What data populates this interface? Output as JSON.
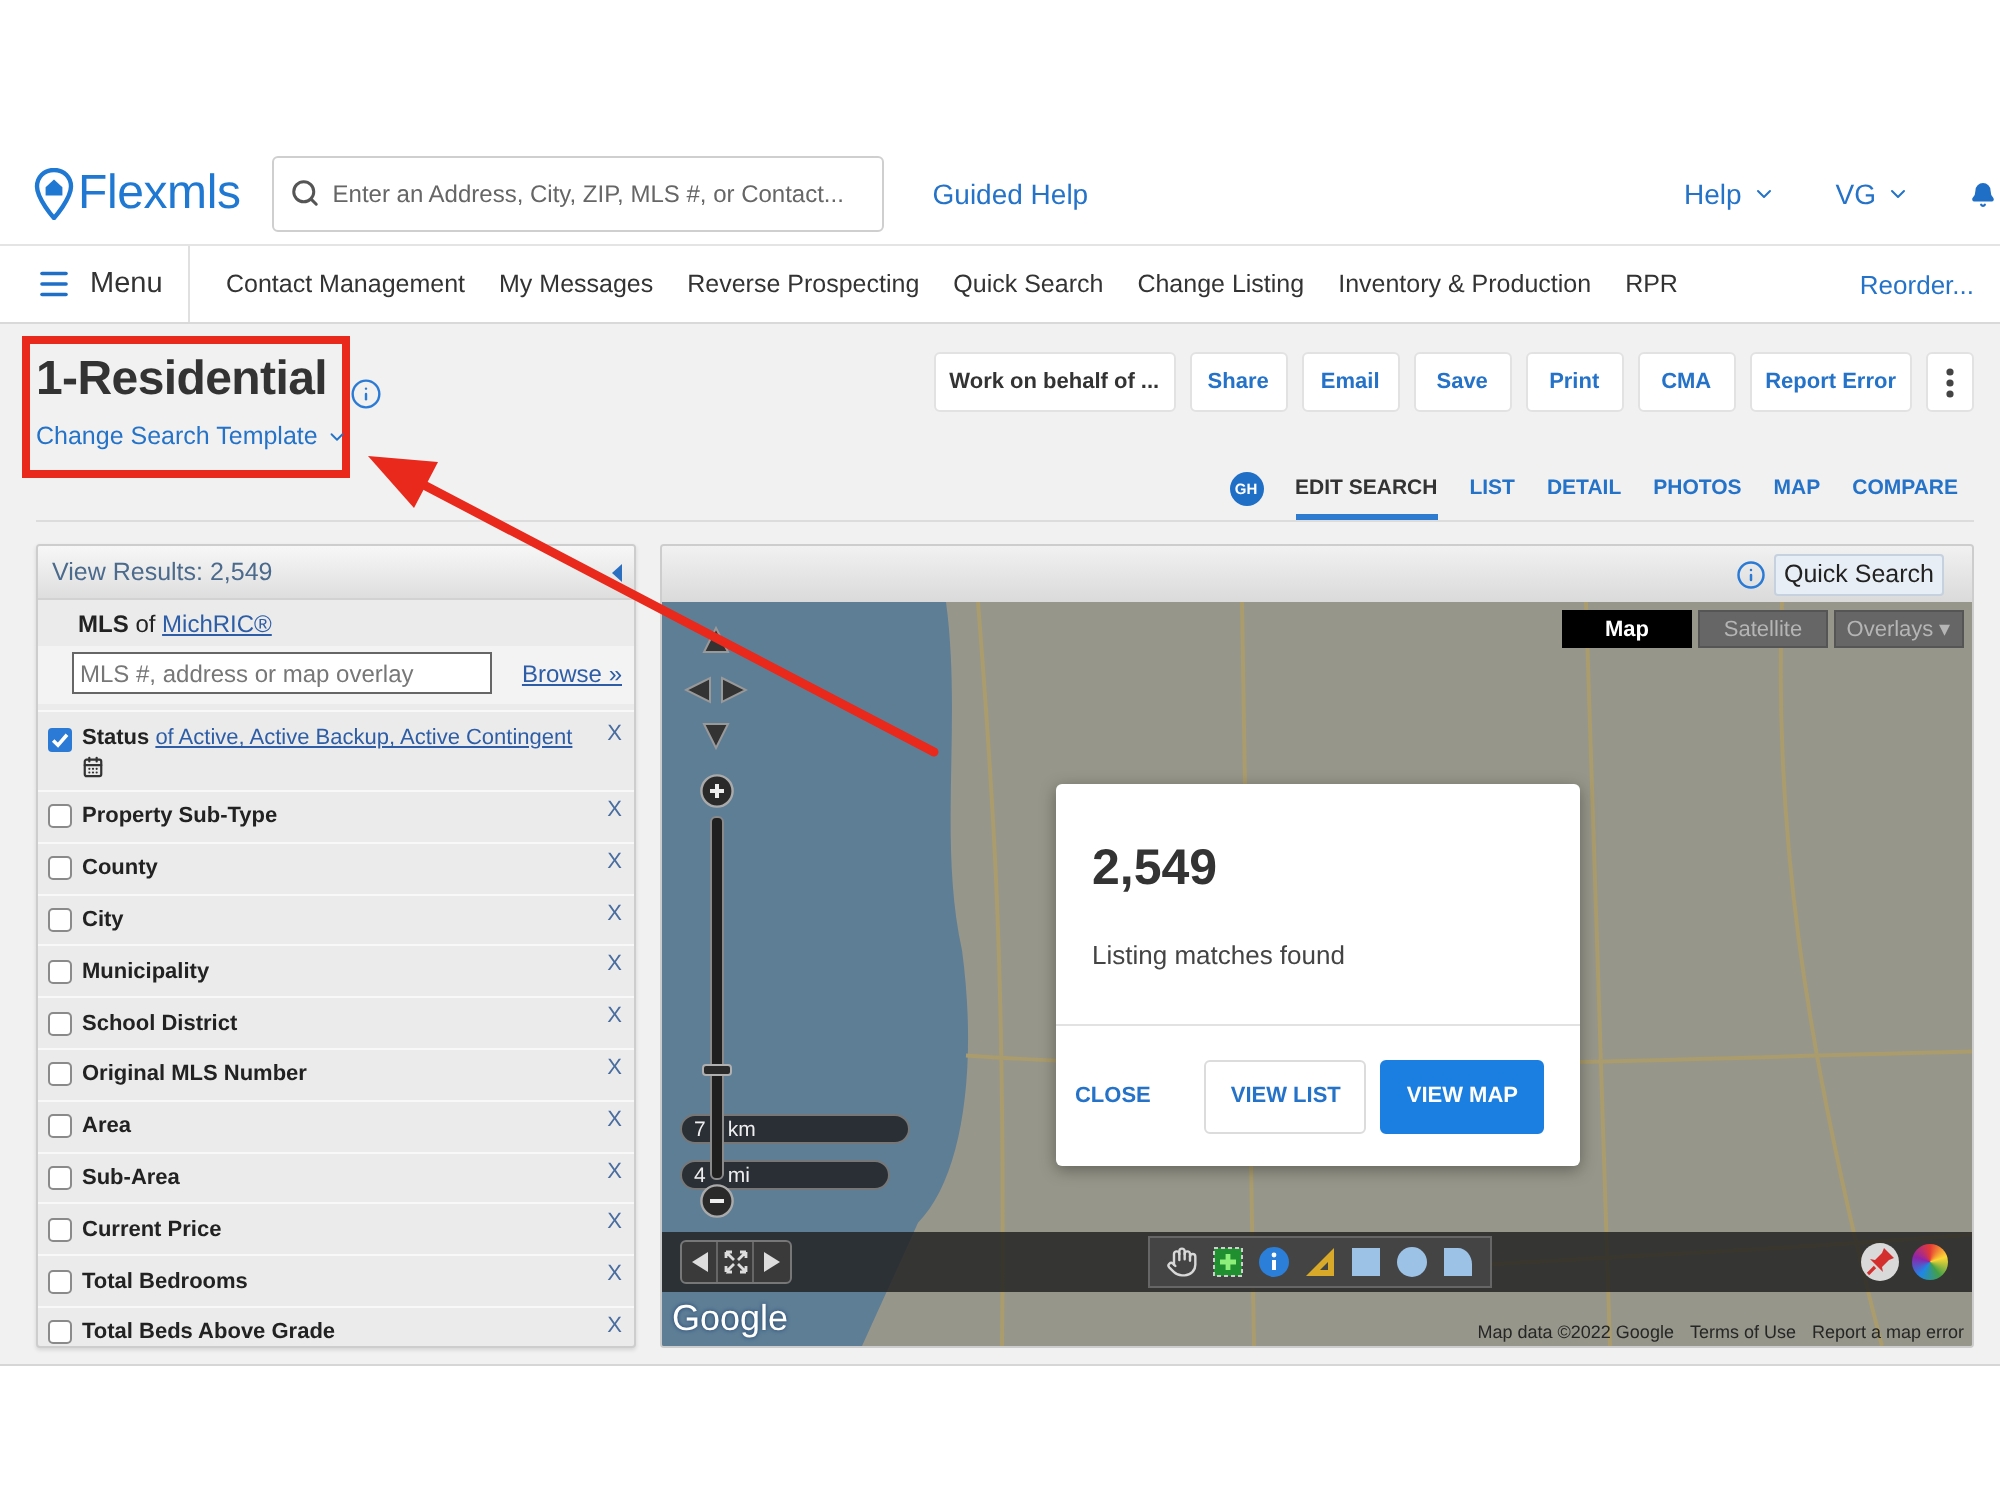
{
  "header": {
    "logo": "Flexmls",
    "search": {
      "placeholder": "Enter an Address, City, ZIP, MLS #, or Contact..."
    },
    "guided_help": "Guided Help",
    "menus": [
      {
        "label": "Help"
      },
      {
        "label": "VG"
      }
    ]
  },
  "nav": {
    "menu": "Menu",
    "items": [
      {
        "label": "Contact Management"
      },
      {
        "label": "My Messages"
      },
      {
        "label": "Reverse Prospecting"
      },
      {
        "label": "Quick Search"
      },
      {
        "label": "Change Listing"
      },
      {
        "label": "Inventory & Production"
      },
      {
        "label": "RPR"
      }
    ],
    "reorder": "Reorder..."
  },
  "search_template": {
    "title": "1-Residential",
    "change_link": "Change Search Template"
  },
  "actions": [
    {
      "label": "Work on behalf of ...",
      "kind": "menu"
    },
    {
      "label": "Share",
      "kind": "action"
    },
    {
      "label": "Email",
      "kind": "action"
    },
    {
      "label": "Save",
      "kind": "action"
    },
    {
      "label": "Print",
      "kind": "action"
    },
    {
      "label": "CMA",
      "kind": "action"
    },
    {
      "label": "Report Error",
      "kind": "action"
    }
  ],
  "view_tabs": {
    "avatar": "GH",
    "tabs": [
      {
        "label": "EDIT SEARCH",
        "selected": true
      },
      {
        "label": "LIST",
        "selected": false
      },
      {
        "label": "DETAIL",
        "selected": false
      },
      {
        "label": "PHOTOS",
        "selected": false
      },
      {
        "label": "MAP",
        "selected": false
      },
      {
        "label": "COMPARE",
        "selected": false
      }
    ]
  },
  "criteria": {
    "header": "View Results: 2,549",
    "mls": {
      "label": "MLS",
      "connector": "of",
      "source": "MichRIC®"
    },
    "search": {
      "placeholder": "MLS #, address or map overlay"
    },
    "browse": "Browse »",
    "fields": [
      {
        "label": "Status",
        "checked": true,
        "value": "of Active, Active Backup, Active Contingent",
        "remove": "X"
      },
      {
        "label": "Property Sub-Type",
        "checked": false,
        "remove": "X"
      },
      {
        "label": "County",
        "checked": false,
        "remove": "X"
      },
      {
        "label": "City",
        "checked": false,
        "remove": "X"
      },
      {
        "label": "Municipality",
        "checked": false,
        "remove": "X"
      },
      {
        "label": "School District",
        "checked": false,
        "remove": "X"
      },
      {
        "label": "Original MLS Number",
        "checked": false,
        "remove": "X"
      },
      {
        "label": "Area",
        "checked": false,
        "remove": "X"
      },
      {
        "label": "Sub-Area",
        "checked": false,
        "remove": "X"
      },
      {
        "label": "Current Price",
        "checked": false,
        "remove": "X"
      },
      {
        "label": "Total Bedrooms",
        "checked": false,
        "remove": "X"
      },
      {
        "label": "Total Beds Above Grade",
        "checked": false,
        "remove": "X"
      }
    ]
  },
  "map": {
    "quick_search": "Quick Search",
    "map_types": [
      {
        "label": "Map",
        "selected": true
      },
      {
        "label": "Satellite",
        "selected": false
      },
      {
        "label": "Overlays ▾",
        "selected": false
      }
    ],
    "zoom": {
      "level": 0.3
    },
    "scales": [
      {
        "value": "7",
        "unit": "km"
      },
      {
        "value": "4",
        "unit": "mi"
      }
    ],
    "logo": "Google",
    "attribution": [
      {
        "label": "Map data ©2022 Google"
      },
      {
        "label": "Terms of Use"
      },
      {
        "label": "Report a map error"
      }
    ]
  },
  "dialog": {
    "count": "2,549",
    "message": "Listing matches found",
    "buttons": [
      {
        "label": "CLOSE",
        "kind": "text"
      },
      {
        "label": "VIEW LIST",
        "kind": "outline"
      },
      {
        "label": "VIEW MAP",
        "kind": "primary"
      }
    ]
  }
}
